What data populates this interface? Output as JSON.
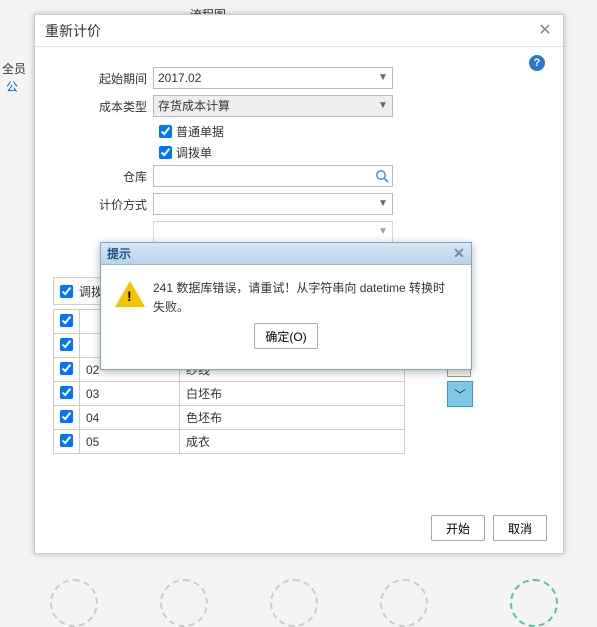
{
  "bg": {
    "flow": "流程图",
    "members": "全员",
    "gong": "公"
  },
  "dialog": {
    "title": "重新计价",
    "help": "?",
    "labels": {
      "period": "起始期间",
      "costType": "成本类型",
      "normalBill": "普通单据",
      "transferBill": "调拨单",
      "warehouse": "仓库",
      "priceMethod": "计价方式"
    },
    "values": {
      "period": "2017.02",
      "costType": "存货成本计算",
      "normalBillChecked": true,
      "transferBillChecked": true,
      "warehouse": "",
      "priceMethod": ""
    },
    "tableHeader": "调拨仓",
    "rows": [
      {
        "c1": "",
        "c2": ""
      },
      {
        "c1": "",
        "c2": ""
      },
      {
        "c1": "02",
        "c2": "纱线"
      },
      {
        "c1": "03",
        "c2": "白坯布"
      },
      {
        "c1": "04",
        "c2": "色坯布"
      },
      {
        "c1": "05",
        "c2": "成衣"
      }
    ],
    "sideDown": "﹀",
    "buttons": {
      "start": "开始",
      "cancel": "取消"
    }
  },
  "alert": {
    "title": "提示",
    "msg": "241 数据库错误，请重试！从字符串向 datetime 转换时失败。",
    "ok": "确定(O)",
    "okKey": "O"
  }
}
